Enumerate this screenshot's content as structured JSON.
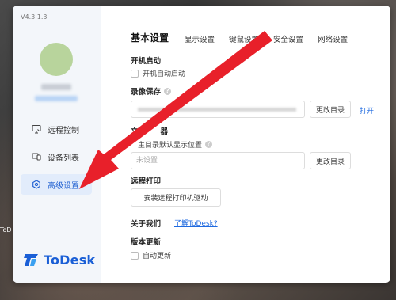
{
  "app": {
    "version": "V4.3.1.3",
    "brand": "ToDesk",
    "accent_color": "#1f5fd1"
  },
  "sidebar": {
    "items": [
      {
        "label": "远程控制",
        "icon": "monitor-icon"
      },
      {
        "label": "设备列表",
        "icon": "devices-icon"
      },
      {
        "label": "高级设置",
        "icon": "settings-gear-icon",
        "active": true
      }
    ]
  },
  "tabs": [
    {
      "label": "基本设置",
      "active": true
    },
    {
      "label": "显示设置"
    },
    {
      "label": "键鼠设置"
    },
    {
      "label": "安全设置"
    },
    {
      "label": "网络设置"
    }
  ],
  "startup": {
    "heading": "开机启动",
    "checkbox_label": "开机自动启动",
    "checked": false
  },
  "recording": {
    "heading": "录像保存",
    "change_dir": "更改目录",
    "open": "打开"
  },
  "file_transfer": {
    "heading_visible": "文",
    "heading_tail": "器",
    "sub_prefix": "",
    "sub_label": "主目录默认显示位置",
    "placeholder": "未设置",
    "change_dir": "更改目录"
  },
  "remote_print": {
    "heading": "远程打印",
    "button": "安装远程打印机驱动"
  },
  "about": {
    "heading": "关于我们",
    "link": "了解ToDesk?"
  },
  "update": {
    "heading": "版本更新",
    "checkbox_label": "自动更新",
    "checked": false
  },
  "desktop": {
    "icon_label": "ToD"
  },
  "annotation": {
    "arrow_color": "#e8202a"
  }
}
